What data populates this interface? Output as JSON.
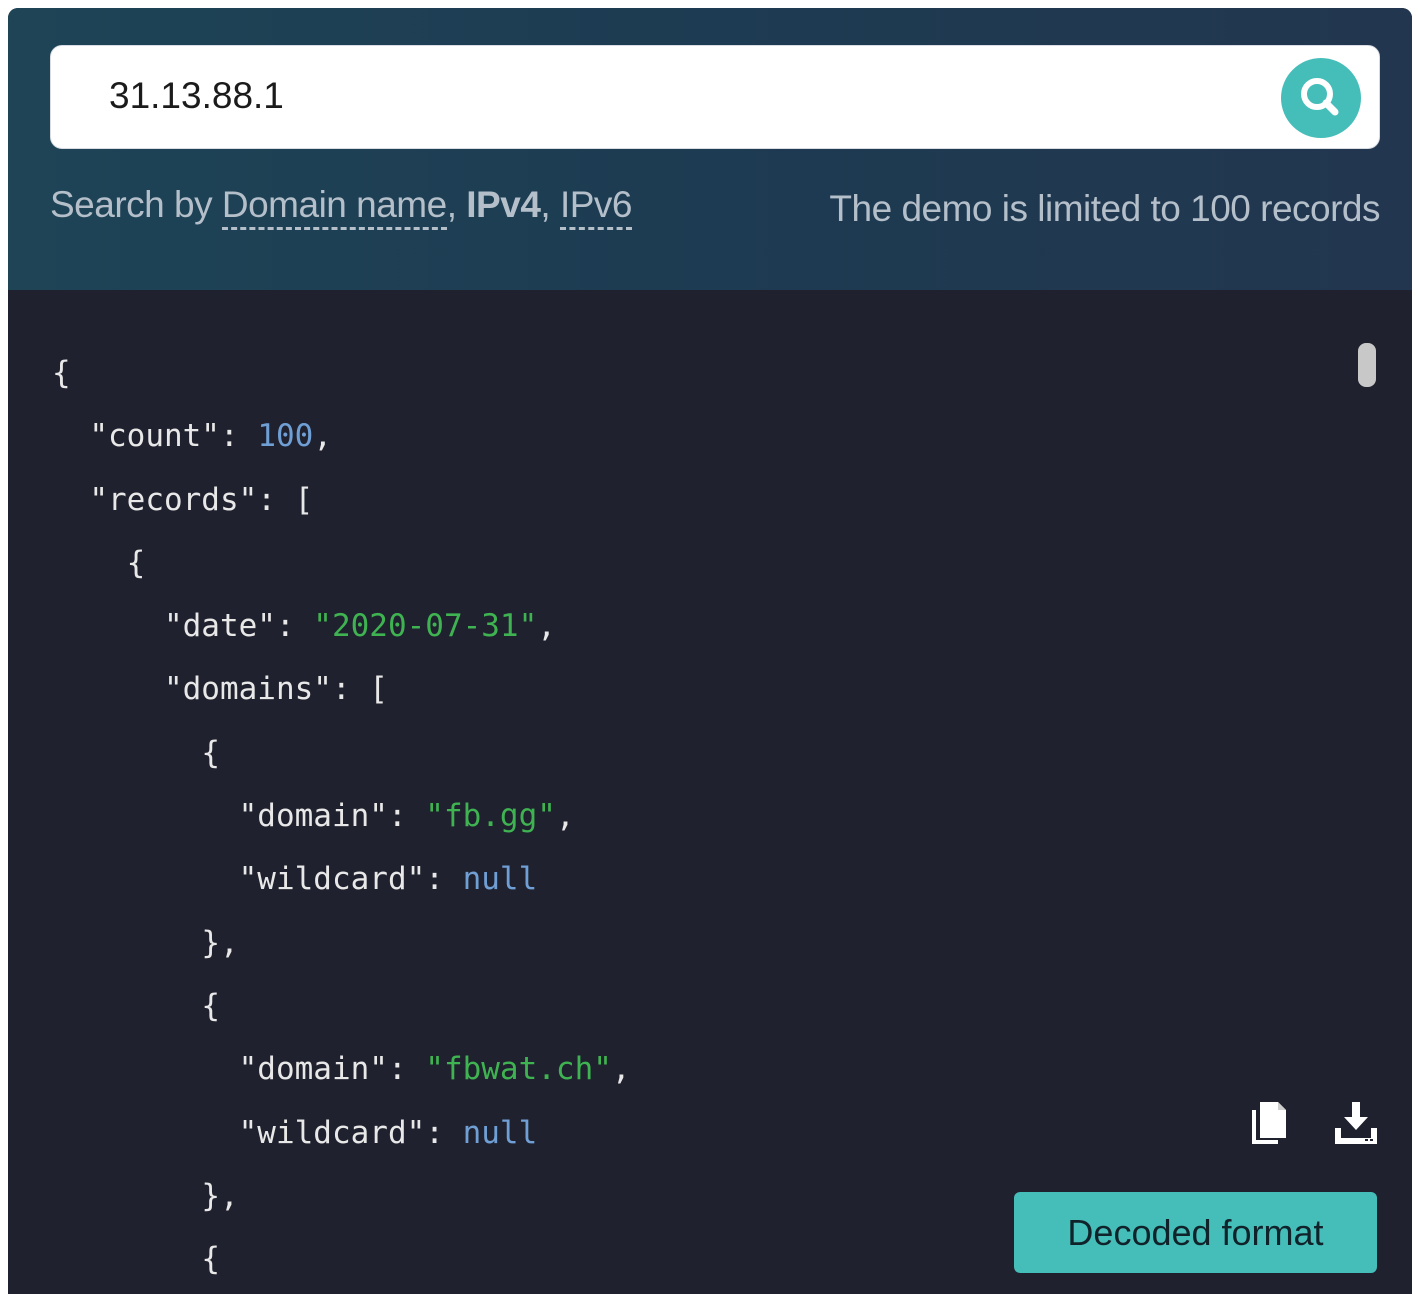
{
  "search": {
    "value": "31.13.88.1",
    "hint_prefix": "Search by ",
    "hint_domain": "Domain name",
    "hint_sep1": ", ",
    "hint_ipv4": "IPv4",
    "hint_sep2": ", ",
    "hint_ipv6": "IPv6",
    "limit_note": "The demo is limited to 100 records"
  },
  "result": {
    "lines": [
      {
        "indent": "",
        "parts": [
          {
            "t": "{",
            "c": "key"
          }
        ]
      },
      {
        "indent": "  ",
        "parts": [
          {
            "t": "\"count\": ",
            "c": "key"
          },
          {
            "t": "100",
            "c": "num"
          },
          {
            "t": ",",
            "c": "key"
          }
        ]
      },
      {
        "indent": "  ",
        "parts": [
          {
            "t": "\"records\": [",
            "c": "key"
          }
        ]
      },
      {
        "indent": "    ",
        "parts": [
          {
            "t": "{",
            "c": "key"
          }
        ]
      },
      {
        "indent": "      ",
        "parts": [
          {
            "t": "\"date\": ",
            "c": "key"
          },
          {
            "t": "\"2020-07-31\"",
            "c": "str"
          },
          {
            "t": ",",
            "c": "key"
          }
        ]
      },
      {
        "indent": "      ",
        "parts": [
          {
            "t": "\"domains\": [",
            "c": "key"
          }
        ]
      },
      {
        "indent": "        ",
        "parts": [
          {
            "t": "{",
            "c": "key"
          }
        ]
      },
      {
        "indent": "          ",
        "parts": [
          {
            "t": "\"domain\": ",
            "c": "key"
          },
          {
            "t": "\"fb.gg\"",
            "c": "str"
          },
          {
            "t": ",",
            "c": "key"
          }
        ]
      },
      {
        "indent": "          ",
        "parts": [
          {
            "t": "\"wildcard\": ",
            "c": "key"
          },
          {
            "t": "null",
            "c": "nul"
          }
        ]
      },
      {
        "indent": "        ",
        "parts": [
          {
            "t": "},",
            "c": "key"
          }
        ]
      },
      {
        "indent": "        ",
        "parts": [
          {
            "t": "{",
            "c": "key"
          }
        ]
      },
      {
        "indent": "          ",
        "parts": [
          {
            "t": "\"domain\": ",
            "c": "key"
          },
          {
            "t": "\"fbwat.ch\"",
            "c": "str"
          },
          {
            "t": ",",
            "c": "key"
          }
        ]
      },
      {
        "indent": "          ",
        "parts": [
          {
            "t": "\"wildcard\": ",
            "c": "key"
          },
          {
            "t": "null",
            "c": "nul"
          }
        ]
      },
      {
        "indent": "        ",
        "parts": [
          {
            "t": "},",
            "c": "key"
          }
        ]
      },
      {
        "indent": "        ",
        "parts": [
          {
            "t": "{",
            "c": "key"
          }
        ]
      }
    ]
  },
  "actions": {
    "copy_icon": "copy-icon",
    "download_icon": "download-icon",
    "decoded_label": "Decoded format"
  },
  "colors": {
    "accent": "#45bdb9",
    "code_bg": "#1f212e",
    "string": "#3fb351",
    "number": "#6f9fd4"
  }
}
